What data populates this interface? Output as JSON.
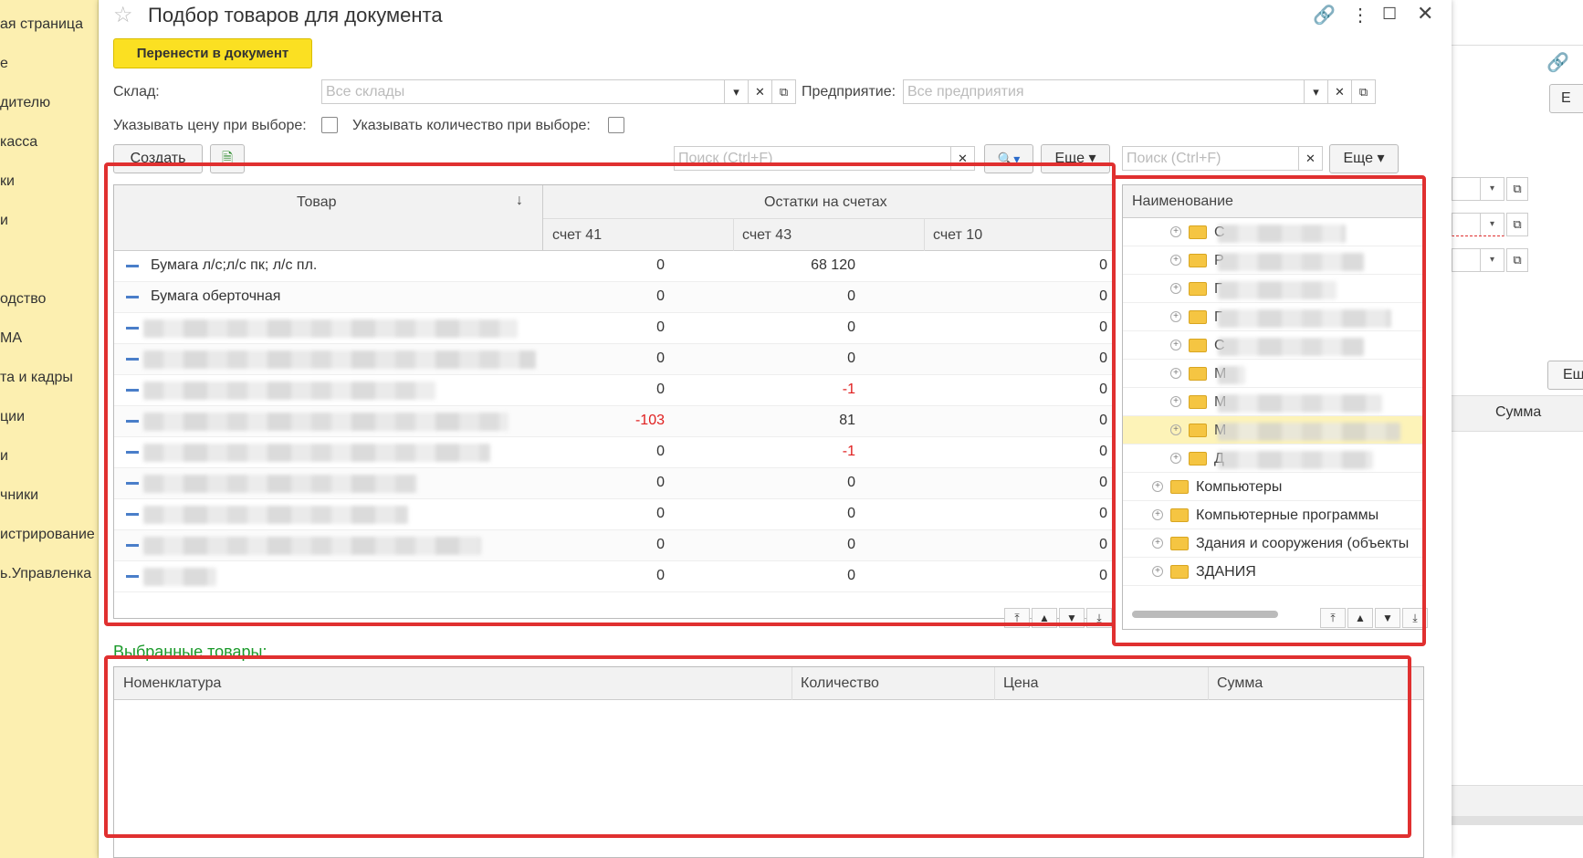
{
  "left_nav": {
    "items": [
      "ая страница",
      "е",
      "дителю",
      "касса",
      "ки",
      "и",
      "одство",
      "МА",
      "та и кадры",
      "ции",
      "и",
      "чники",
      "истрирование",
      "ь.Управленка"
    ]
  },
  "dialog": {
    "title": "Подбор товаров для документа",
    "transfer_button": "Перенести в документ",
    "warehouse_label": "Склад:",
    "warehouse_placeholder": "Все склады",
    "enterprise_label": "Предприятие:",
    "enterprise_placeholder": "Все предприятия",
    "price_on_select_label": "Указывать цену при выборе:",
    "qty_on_select_label": "Указывать количество при выборе:",
    "create_button": "Создать",
    "search_placeholder": "Поиск (Ctrl+F)",
    "more_button": "Еще",
    "more_button_2": "Еще",
    "search_placeholder_2": "Поиск (Ctrl+F)"
  },
  "goods_table": {
    "col_product": "Товар",
    "col_balances_group": "Остатки на счетах",
    "col_acc41": "счет 41",
    "col_acc43": "счет 43",
    "col_acc10": "счет 10",
    "rows": [
      {
        "name": "Бумага л/с;л/с пк; л/с пл.",
        "a41": "0",
        "a43": "68 120",
        "a10": "0"
      },
      {
        "name": "Бумага оберточная",
        "a41": "0",
        "a43": "0",
        "a10": "0"
      },
      {
        "name": "",
        "a41": "0",
        "a43": "0",
        "a10": "0"
      },
      {
        "name": "",
        "a41": "0",
        "a43": "0",
        "a10": "0"
      },
      {
        "name": "",
        "a41": "0",
        "a43": "-1",
        "a10": "0"
      },
      {
        "name": "",
        "a41": "-103",
        "a43": "81",
        "a10": "0"
      },
      {
        "name": "",
        "a41": "0",
        "a43": "-1",
        "a10": "0"
      },
      {
        "name": "",
        "a41": "0",
        "a43": "0",
        "a10": "0"
      },
      {
        "name": "",
        "a41": "0",
        "a43": "0",
        "a10": "0"
      },
      {
        "name": "",
        "a41": "0",
        "a43": "0",
        "a10": "0"
      },
      {
        "name": "",
        "a41": "0",
        "a43": "0",
        "a10": "0"
      }
    ]
  },
  "groups_tree": {
    "col_name": "Наименование",
    "blurred_rows": [
      "С",
      "Р",
      "Г",
      "Г",
      "С",
      "М",
      "М",
      "М",
      "Д"
    ],
    "rows": [
      "Компьютеры",
      "Компьютерные программы",
      "Здания и сооружения (объекты",
      "ЗДАНИЯ"
    ]
  },
  "selected": {
    "title": "Выбранные товары:",
    "col_nomenclature": "Номенклатура",
    "col_qty": "Количество",
    "col_price": "Цена",
    "col_sum": "Сумма"
  },
  "right_bg": {
    "summa_label": "Сумма",
    "btn_b": "Е",
    "btn_e": "Ещ"
  },
  "colors": {
    "accent_yellow": "#fbe022",
    "annotation_red": "#e03030",
    "negative": "#e02020",
    "section_green": "#1a9a2a"
  }
}
